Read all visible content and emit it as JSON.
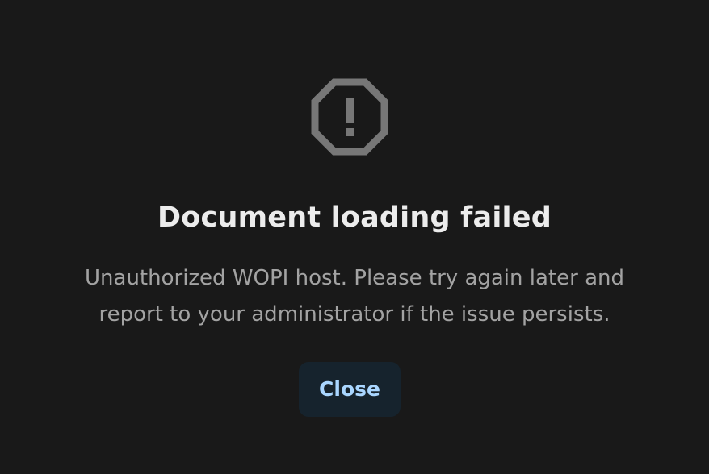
{
  "dialog": {
    "icon": "warning-octagon-icon",
    "title": "Document loading failed",
    "message_lines": [
      "Unauthorized WOPI host. Please try again later and",
      "report to your administrator if the issue persists."
    ],
    "close_label": "Close"
  },
  "colors": {
    "background": "#191919",
    "title": "#ececec",
    "message": "#a3a3a3",
    "icon": "#777777",
    "button_background": "#16232d",
    "button_text": "#a9d6ff"
  }
}
